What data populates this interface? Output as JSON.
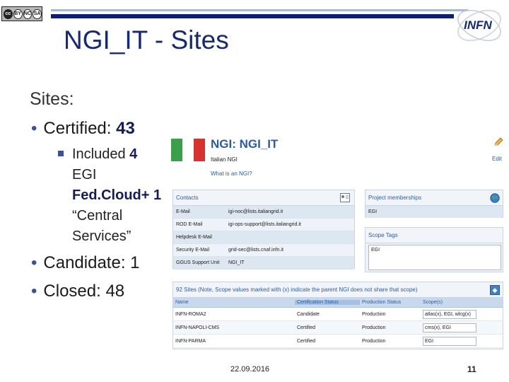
{
  "header": {
    "title": "NGI_IT - Sites",
    "logo_text": "INFN",
    "license_badge": [
      "cc",
      "BY",
      "NC",
      "SA"
    ]
  },
  "body": {
    "heading": "Sites:",
    "certified_label": "Certified: ",
    "certified_value": "43",
    "sub_prefix": "Included ",
    "sub_count": "4",
    "sub_mid": " EGI ",
    "sub_bold": "Fed.Cloud+ 1",
    "sub_suffix": " “Central Services”",
    "candidate": "Candidate: 1",
    "closed": "Closed: 48"
  },
  "screenshot": {
    "title": "NGI: NGI_IT",
    "subtitle": "Italian NGI",
    "link": "What is an NGI?",
    "edit_label": "Edit",
    "flag_colors": [
      "#3ba04a",
      "#ffffff",
      "#d8322f"
    ],
    "contacts": {
      "header": "Contacts",
      "rows": [
        {
          "key": "E-Mail",
          "value": "igi-noc@lists.italiangrid.it"
        },
        {
          "key": "ROD E-Mail",
          "value": "igi-ops-support@lists.italiangrid.it"
        },
        {
          "key": "Helpdesk E-Mail",
          "value": ""
        },
        {
          "key": "Security E-Mail",
          "value": "grid-sec@lists.cnaf.infn.it"
        },
        {
          "key": "GGUS Support Unit",
          "value": "NGI_IT"
        }
      ]
    },
    "memberships": {
      "header": "Project memberships",
      "value": "EGI"
    },
    "scope_tags": {
      "header": "Scope Tags",
      "value": "EGI"
    },
    "sites": {
      "header": "92 Sites (Note, Scope values marked with (x) indicate the parent NGI does not share that scope)",
      "columns": [
        "Name",
        "Certification Status",
        "Production Status",
        "Scope(s)"
      ],
      "rows": [
        {
          "name": "INFN-ROMA2",
          "cert": "Candidate",
          "prod": "Production",
          "scope": "atlas(x), EGI, wlcg(x)"
        },
        {
          "name": "INFN-NAPOLI-CMS",
          "cert": "Certified",
          "prod": "Production",
          "scope": "cms(x), EGI"
        },
        {
          "name": "INFN-PARMA",
          "cert": "Certified",
          "prod": "Production",
          "scope": "EGI"
        }
      ]
    }
  },
  "footer": {
    "date": "22.09.2016",
    "page": "11"
  },
  "colors": {
    "title": "#14287e",
    "bar_dark": "#0c1e7a",
    "bar_light": "#9bbde0",
    "bullet": "#3a4fa0",
    "link": "#2b5ba8"
  }
}
